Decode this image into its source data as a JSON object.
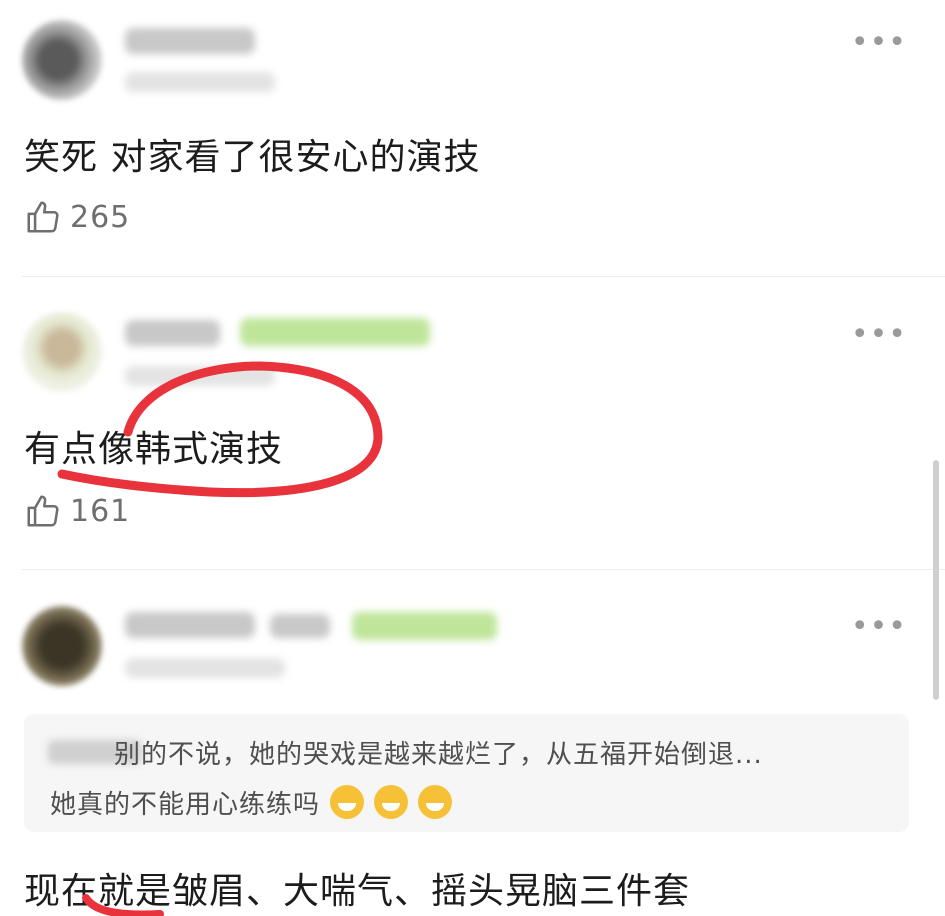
{
  "comments": [
    {
      "text": "笑死 对家看了很安心的演技",
      "likes": "265",
      "like_icon": "thumbs-up-icon",
      "more_icon": "•••"
    },
    {
      "text": "有点像韩式演技",
      "likes": "161",
      "like_icon": "thumbs-up-icon",
      "more_icon": "•••"
    },
    {
      "quote": {
        "line1": "别的不说，她的哭戏是越来越烂了，从五福开始倒退...",
        "line2": "她真的不能用心练练吗",
        "emoji_icon": "sweat-smile-emoji"
      },
      "text": "现在就是皱眉、大喘气、摇头晃脑三件套",
      "more_icon": "•••"
    }
  ],
  "colors": {
    "annotation": "#e8323c",
    "like_count": "#6f6f6f",
    "background": "#ffffff",
    "quote_bg": "#f6f6f6",
    "badge": "#bfe59a"
  }
}
